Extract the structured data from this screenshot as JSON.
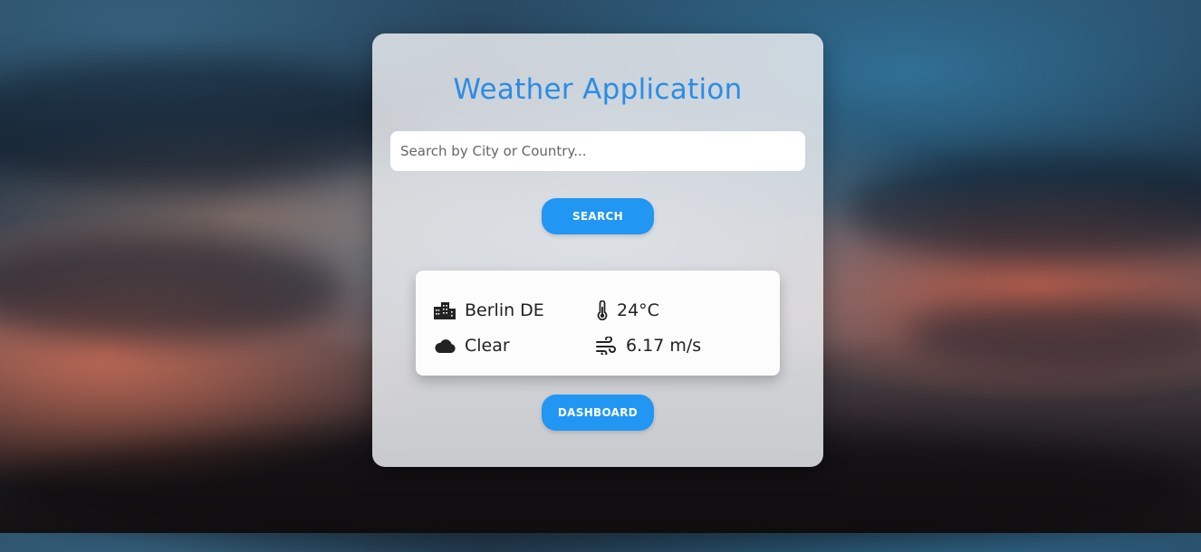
{
  "app": {
    "title": "Weather Application"
  },
  "search": {
    "placeholder": "Search by City or Country...",
    "value": "",
    "button_label": "SEARCH"
  },
  "weather": {
    "location": "Berlin DE",
    "temperature": "24°C",
    "condition": "Clear",
    "wind": "6.17 m/s",
    "icons": {
      "location": "city-buildings-icon",
      "temperature": "thermometer-icon",
      "condition": "cloud-icon",
      "wind": "wind-icon"
    }
  },
  "actions": {
    "dashboard_label": "DASHBOARD"
  },
  "colors": {
    "accent": "#2196f3",
    "title": "#2b8ce6",
    "card_background": "#e8eaee",
    "text": "#222222"
  }
}
